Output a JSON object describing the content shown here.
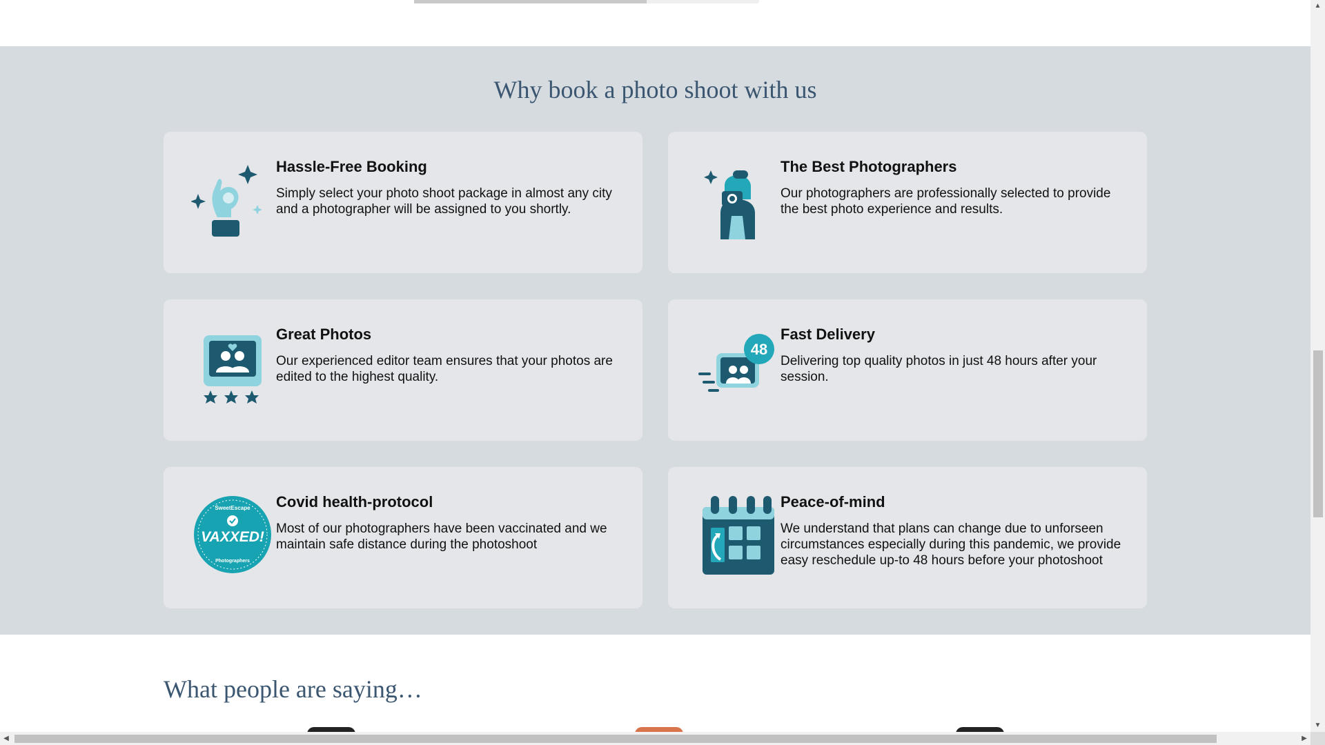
{
  "why": {
    "title": "Why book a photo shoot with us",
    "cards": [
      {
        "title": "Hassle-Free Booking",
        "desc": "Simply select your photo shoot package in almost any city and a photographer will be assigned to you shortly."
      },
      {
        "title": "The Best Photographers",
        "desc": "Our photographers are professionally selected to provide the best photo experience and results."
      },
      {
        "title": "Great Photos",
        "desc": "Our experienced editor team ensures that your photos are edited to the highest quality."
      },
      {
        "title": "Fast Delivery",
        "desc": "Delivering top quality photos in just 48 hours after your session."
      },
      {
        "title": "Covid health-protocol",
        "desc": "Most of our photographers have been vaccinated and we maintain safe distance during the photoshoot"
      },
      {
        "title": "Peace-of-mind",
        "desc": "We understand that plans can change due to unforseen circumstances especially during this pandemic, we provide easy reschedule up-to 48 hours before your photoshoot"
      }
    ],
    "badge_48": "48",
    "vaxxed": {
      "main": "VAXXED!",
      "top": "SweetEscape",
      "bottom": "Photographers"
    }
  },
  "testimonials": {
    "title": "What people are saying…"
  },
  "colors": {
    "section_bg": "#d6dbe0",
    "card_bg": "#e4e6e9",
    "heading": "#3b5670",
    "icon_dark": "#1d5a70",
    "icon_light": "#8fd3df",
    "icon_teal": "#22a8b8"
  },
  "icons": [
    "ok-hand-icon",
    "photographer-icon",
    "rated-photo-icon",
    "fast-delivery-icon",
    "vaxxed-badge-icon",
    "calendar-reschedule-icon"
  ]
}
